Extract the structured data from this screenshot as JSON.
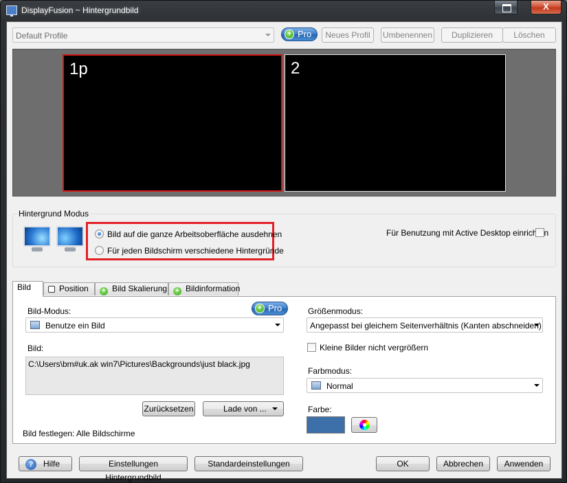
{
  "window": {
    "title": "DisplayFusion ~ Hintergrundbild",
    "close_glyph": "X"
  },
  "toolbar": {
    "profile_value": "Default Profile",
    "pro_label": "Pro",
    "new_profile": "Neues Profil",
    "rename": "Umbenennen",
    "duplicate": "Duplizieren",
    "delete": "Löschen"
  },
  "preview": {
    "monitors": [
      {
        "label": "1p",
        "selected": true
      },
      {
        "label": "2",
        "selected": false
      }
    ],
    "selected_border_color": "#d41717"
  },
  "mode": {
    "title": "Hintergrund Modus",
    "option_stretch": "Bild auf die ganze Arbeitsoberfläche ausdehnen",
    "option_separate": "Für jeden Bildschirm verschiedene Hintergründe",
    "selected": "stretch",
    "active_desktop_label": "Für Benutzung mit Active Desktop einrichten",
    "active_desktop_checked": false,
    "highlight_color": "#e21f26"
  },
  "tabs": [
    {
      "label": "Bild",
      "active": true
    },
    {
      "label": "Position",
      "icon": "square-icon"
    },
    {
      "label": "Bild Skalierung",
      "icon": "green-plus-icon"
    },
    {
      "label": "Bildinformation",
      "icon": "green-plus-icon"
    }
  ],
  "bild_tab": {
    "mode_label": "Bild-Modus:",
    "pro_label": "Pro",
    "mode_value": "Benutze ein Bild",
    "image_label": "Bild:",
    "image_path": "C:\\Users\\bm#uk.ak win7\\Pictures\\Backgrounds\\just black.jpg",
    "reset_button": "Zurücksetzen",
    "load_button": "Lade von ...",
    "apply_to": "Bild festlegen: Alle Bildschirme",
    "size_mode_label": "Größenmodus:",
    "size_mode_value": "Angepasst bei gleichem Seitenverhältnis (Kanten abschneiden)",
    "no_enlarge_label": "Kleine Bilder nicht vergrößern",
    "no_enlarge_checked": false,
    "color_mode_label": "Farbmodus:",
    "color_mode_value": "Normal",
    "color_label": "Farbe:",
    "color_value": "#3d6fa8"
  },
  "footer": {
    "help": "Hilfe",
    "help_glyph": "?",
    "wallpaper_settings": "Einstellungen Hintergrundbild",
    "defaults": "Standardeinstellungen",
    "ok": "OK",
    "cancel": "Abbrechen",
    "apply": "Anwenden"
  }
}
